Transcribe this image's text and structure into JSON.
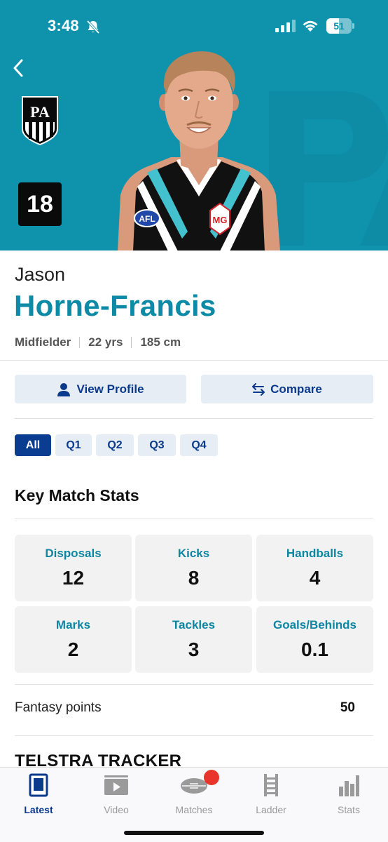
{
  "status_bar": {
    "time": "3:48",
    "battery": "51",
    "battery_level": 0.51
  },
  "player": {
    "number": "18",
    "first_name": "Jason",
    "last_name": "Horne-Francis",
    "position": "Midfielder",
    "age": "22 yrs",
    "height": "185 cm",
    "jersey_sponsor": "MG",
    "jersey_league": "AFL",
    "club_monogram": "PA"
  },
  "actions": {
    "view_profile": "View Profile",
    "compare": "Compare"
  },
  "quarters": {
    "active": "All",
    "tabs": [
      "All",
      "Q1",
      "Q2",
      "Q3",
      "Q4"
    ]
  },
  "key_stats": {
    "title": "Key Match Stats",
    "items": [
      {
        "label": "Disposals",
        "value": "12"
      },
      {
        "label": "Kicks",
        "value": "8"
      },
      {
        "label": "Handballs",
        "value": "4"
      },
      {
        "label": "Marks",
        "value": "2"
      },
      {
        "label": "Tackles",
        "value": "3"
      },
      {
        "label": "Goals/Behinds",
        "value": "0.1"
      }
    ]
  },
  "fantasy": {
    "label": "Fantasy points",
    "value": "50"
  },
  "next_section": {
    "title": "TELSTRA TRACKER"
  },
  "tab_bar": {
    "items": [
      {
        "label": "Latest",
        "icon": "latest-icon",
        "active": true
      },
      {
        "label": "Video",
        "icon": "video-icon",
        "active": false
      },
      {
        "label": "Matches",
        "icon": "football-icon",
        "active": false,
        "badge": true
      },
      {
        "label": "Ladder",
        "icon": "ladder-icon",
        "active": false
      },
      {
        "label": "Stats",
        "icon": "bar-chart-icon",
        "active": false
      }
    ]
  },
  "colors": {
    "hero_background": "#0f93ad",
    "accent_teal": "#0d8aa6",
    "primary_navy": "#0a3d8f",
    "badge_red": "#e8342a"
  }
}
